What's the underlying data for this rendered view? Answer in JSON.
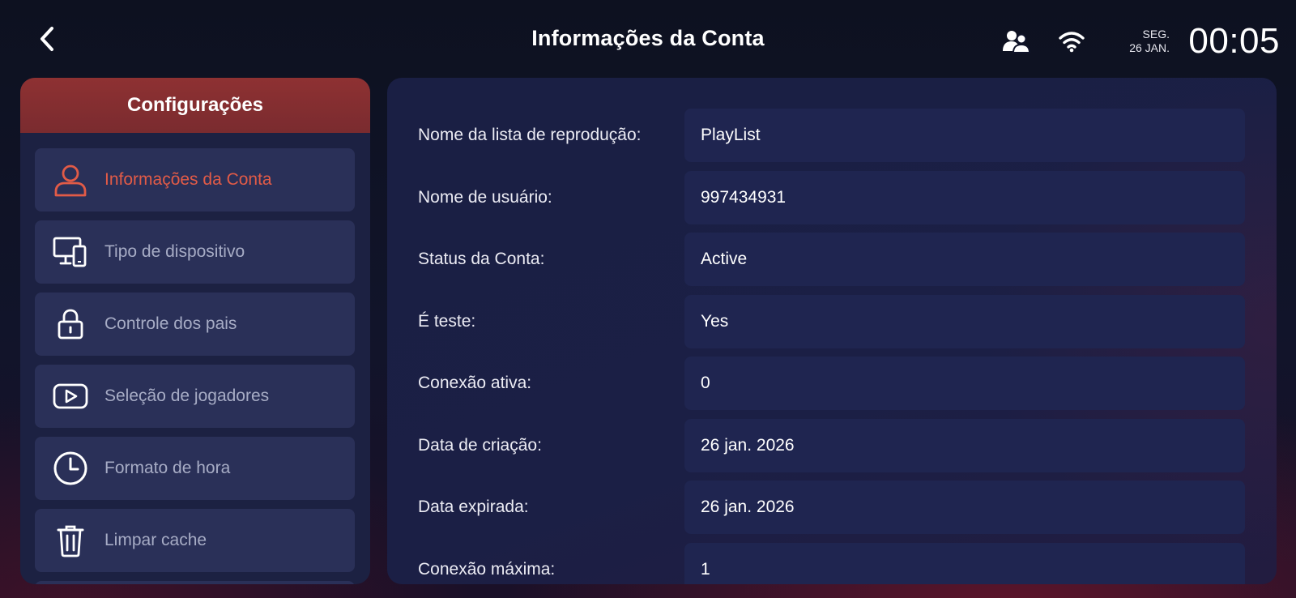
{
  "header": {
    "title": "Informações da Conta",
    "day": "SEG.",
    "date": "26 JAN.",
    "time": "00:05"
  },
  "sidebar": {
    "title": "Configurações",
    "items": [
      {
        "label": "Informações da Conta",
        "icon": "user-icon",
        "active": true
      },
      {
        "label": "Tipo de dispositivo",
        "icon": "devices-icon",
        "active": false
      },
      {
        "label": "Controle dos pais",
        "icon": "lock-icon",
        "active": false
      },
      {
        "label": "Seleção de jogadores",
        "icon": "player-icon",
        "active": false
      },
      {
        "label": "Formato de hora",
        "icon": "clock-icon",
        "active": false
      },
      {
        "label": "Limpar cache",
        "icon": "trash-icon",
        "active": false
      }
    ]
  },
  "account": {
    "rows": [
      {
        "key": "Nome da lista de reprodução:",
        "value": "PlayList"
      },
      {
        "key": "Nome de usuário:",
        "value": "997434931"
      },
      {
        "key": "Status da Conta:",
        "value": "Active"
      },
      {
        "key": "É teste:",
        "value": "Yes"
      },
      {
        "key": "Conexão ativa:",
        "value": "0"
      },
      {
        "key": "Data de criação:",
        "value": "26 jan. 2026"
      },
      {
        "key": "Data expirada:",
        "value": "26 jan. 2026"
      },
      {
        "key": "Conexão máxima:",
        "value": "1"
      }
    ]
  },
  "colors": {
    "accent": "#e25b47",
    "sidebar_header": "#8e3132",
    "menu_item_bg": "#2a3058",
    "panel_bg": "#1a1f44"
  }
}
